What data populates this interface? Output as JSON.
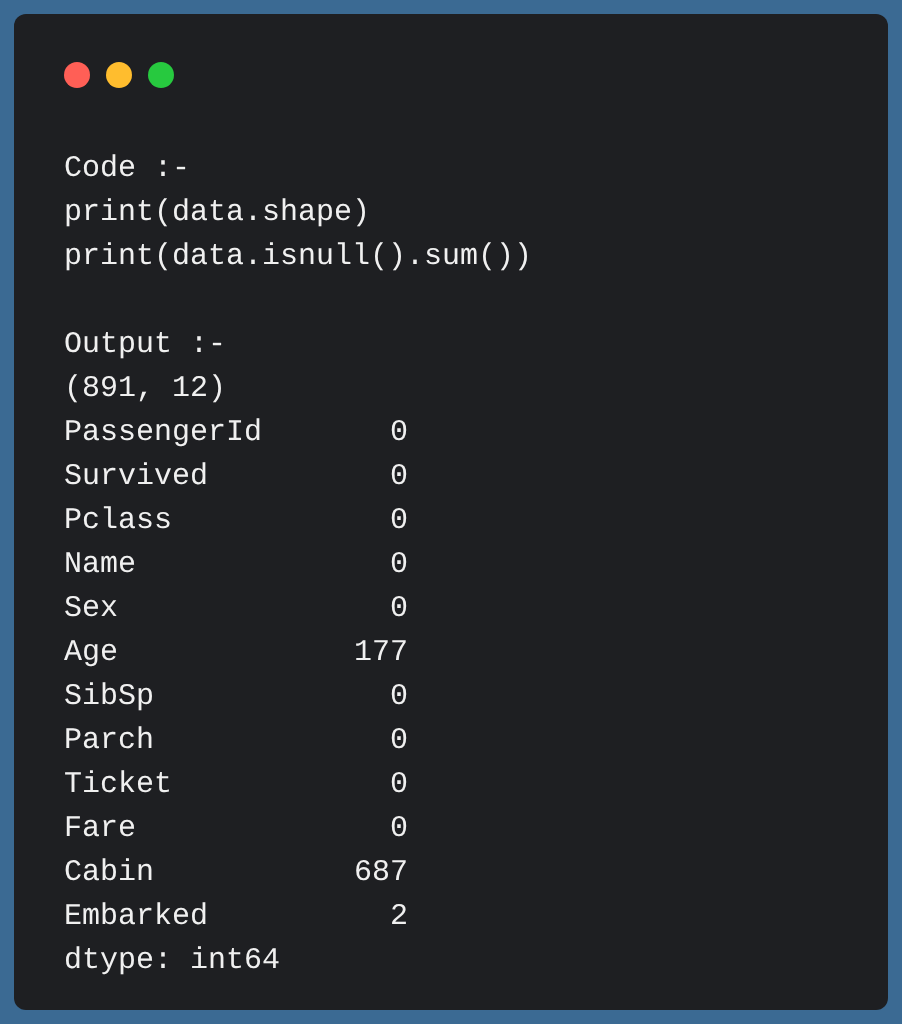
{
  "window_controls": [
    {
      "color": "#ff5f56"
    },
    {
      "color": "#ffbd2e"
    },
    {
      "color": "#27c93f"
    }
  ],
  "code": {
    "label": "Code :-",
    "lines": [
      "print(data.shape)",
      "print(data.isnull().sum())"
    ]
  },
  "output": {
    "label": "Output :-",
    "lines": [
      "(891, 12)"
    ],
    "rows": [
      {
        "column_1": "PassengerId",
        "column_2": "0"
      },
      {
        "column_1": "Survived",
        "column_2": "0"
      },
      {
        "column_1": "Pclass",
        "column_2": "0"
      },
      {
        "column_1": "Name",
        "column_2": "0"
      },
      {
        "column_1": "Sex",
        "column_2": "0"
      },
      {
        "column_1": "Age",
        "column_2": "177"
      },
      {
        "column_1": "SibSp",
        "column_2": "0"
      },
      {
        "column_1": "Parch",
        "column_2": "0"
      },
      {
        "column_1": "Ticket",
        "column_2": "0"
      },
      {
        "column_1": "Fare",
        "column_2": "0"
      },
      {
        "column_1": "Cabin",
        "column_2": "687"
      },
      {
        "column_1": "Embarked",
        "column_2": "2"
      }
    ],
    "footer": "dtype: int64"
  }
}
